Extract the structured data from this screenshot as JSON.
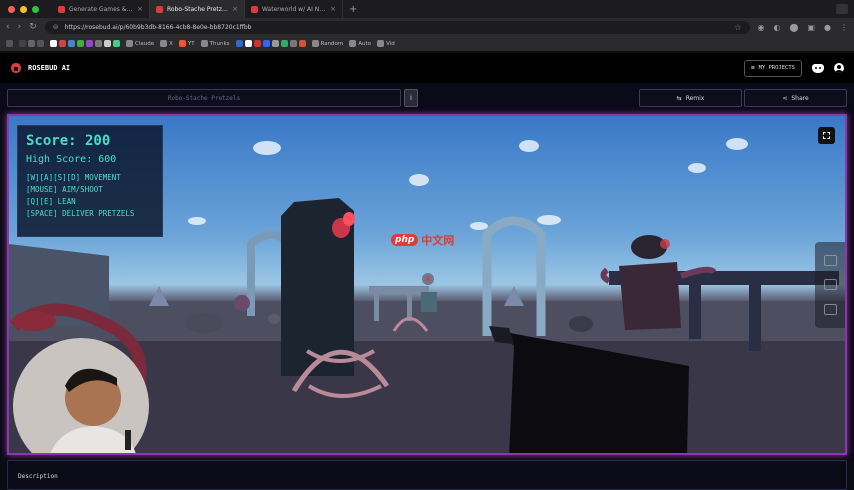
{
  "browser": {
    "tabs": [
      {
        "label": "Generate Games & Apps wit"
      },
      {
        "label": "Robo-Stache Pretzels | Pla"
      },
      {
        "label": "Waterworld w/ AI NPCs (and"
      }
    ],
    "url": "https://rosebud.ai/p/60b9b3db-8166-4cb8-8e0e-bb8720c1ffbb",
    "bookmarks": [
      "Claude",
      "X",
      "YT",
      "Thunks",
      "Random",
      "Auto",
      "Vid"
    ]
  },
  "app": {
    "brand": "ROSEBUD AI",
    "my_projects": "MY PROJECTS",
    "project_title_placeholder": "Robo-Stache Pretzels",
    "info_label": "i",
    "remix_label": "Remix",
    "share_label": "Share",
    "description_label": "Description"
  },
  "hud": {
    "score": "Score: 200",
    "high_score": "High Score: 600",
    "controls": [
      "[W][A][S][D] MOVEMENT",
      "[MOUSE] AIM/SHOOT",
      "[Q][E] LEAN",
      "[SPACE] DELIVER PRETZELS"
    ]
  },
  "watermark": {
    "badge": "php",
    "text": "中文网"
  },
  "colors": {
    "hud_text": "#44e0c8",
    "accent": "#8a3aa8",
    "brand_red": "#e03a3a"
  }
}
